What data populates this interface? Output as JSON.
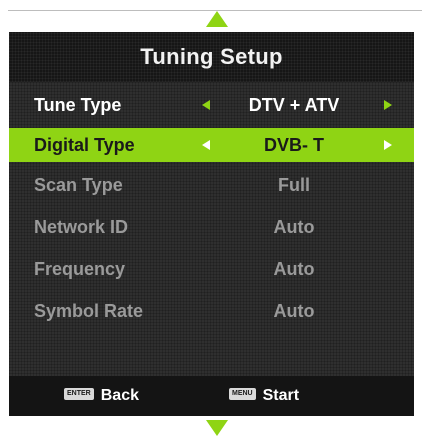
{
  "title": "Tuning Setup",
  "rows": [
    {
      "label": "Tune Type",
      "value": "DTV + ATV",
      "state": "normal",
      "arrows": true
    },
    {
      "label": "Digital Type",
      "value": "DVB- T",
      "state": "selected",
      "arrows": true
    },
    {
      "label": "Scan Type",
      "value": "Full",
      "state": "disabled",
      "arrows": false
    },
    {
      "label": "Network ID",
      "value": "Auto",
      "state": "disabled",
      "arrows": false
    },
    {
      "label": "Frequency",
      "value": "Auto",
      "state": "disabled",
      "arrows": false
    },
    {
      "label": "Symbol Rate",
      "value": "Auto",
      "state": "disabled",
      "arrows": false
    }
  ],
  "footer": {
    "back": {
      "key": "ENTER",
      "label": "Back"
    },
    "start": {
      "key": "MENU",
      "label": "Start"
    }
  },
  "colors": {
    "accent": "#8fd414",
    "panel": "#2f2f2f",
    "title_bar": "#161616",
    "disabled_text": "#9a9a9a"
  },
  "icons": {
    "scroll_up": "triangle-up-icon",
    "scroll_down": "triangle-down-icon",
    "option_left": "triangle-left-icon",
    "option_right": "triangle-right-icon"
  }
}
